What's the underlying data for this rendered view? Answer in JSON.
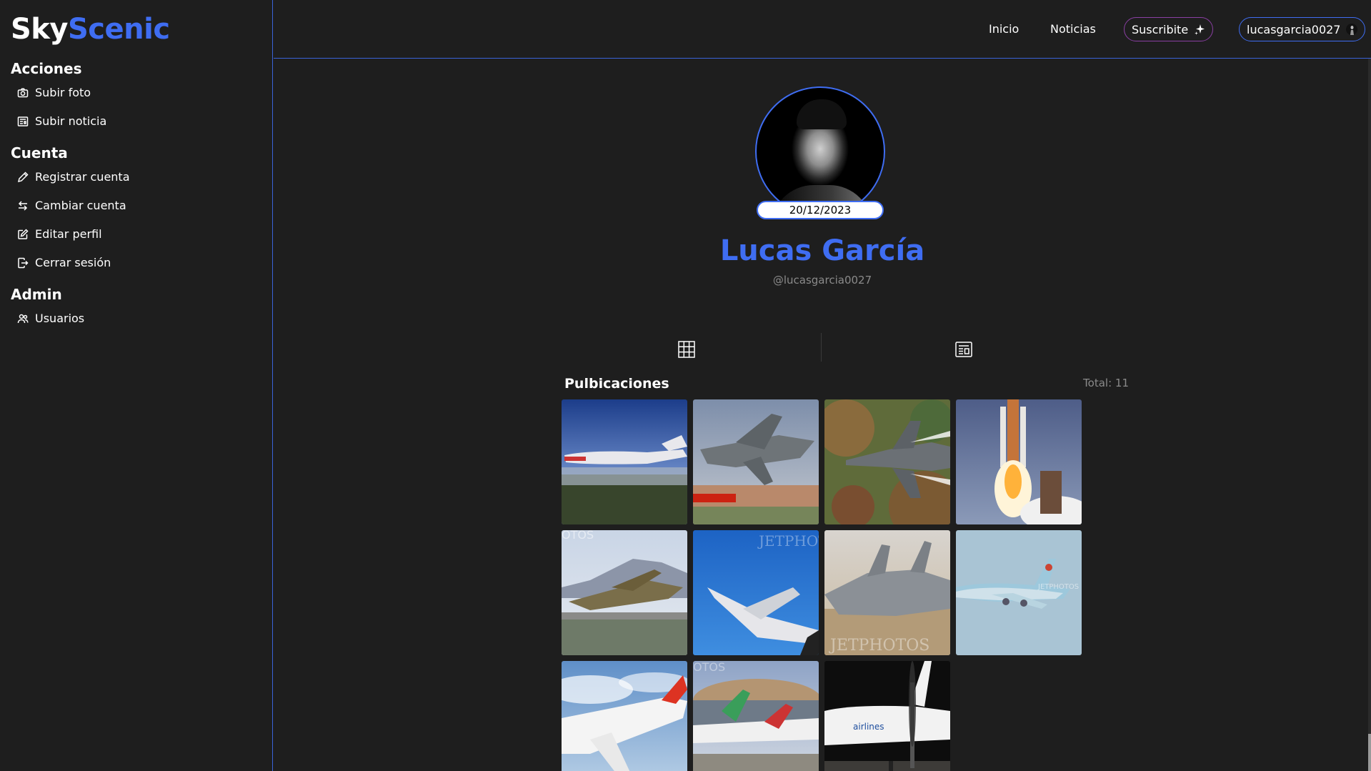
{
  "brand": {
    "part1": "Sky",
    "part2": "Scenic"
  },
  "sidebar": {
    "sections": [
      {
        "title": "Acciones",
        "items": [
          {
            "label": "Subir foto",
            "icon": "camera-icon"
          },
          {
            "label": "Subir noticia",
            "icon": "newspaper-icon"
          }
        ]
      },
      {
        "title": "Cuenta",
        "items": [
          {
            "label": "Registrar cuenta",
            "icon": "pen-icon"
          },
          {
            "label": "Cambiar cuenta",
            "icon": "swap-icon"
          },
          {
            "label": "Editar perfil",
            "icon": "edit-icon"
          },
          {
            "label": "Cerrar sesión",
            "icon": "logout-icon"
          }
        ]
      },
      {
        "title": "Admin",
        "items": [
          {
            "label": "Usuarios",
            "icon": "users-icon"
          }
        ]
      }
    ]
  },
  "topbar": {
    "links": [
      "Inicio",
      "Noticias"
    ],
    "subscribe_label": "Suscribite",
    "user_label": "lucasgarcia0027"
  },
  "profile": {
    "date": "20/12/2023",
    "name": "Lucas García",
    "handle": "@lucasgarcia0027"
  },
  "posts": {
    "title": "Pulbicaciones",
    "total": "Total: 11",
    "count": 11
  },
  "colors": {
    "accent": "#3f6df2",
    "background": "#1e1e1e",
    "subscribe_border": "#8a3fa3"
  }
}
